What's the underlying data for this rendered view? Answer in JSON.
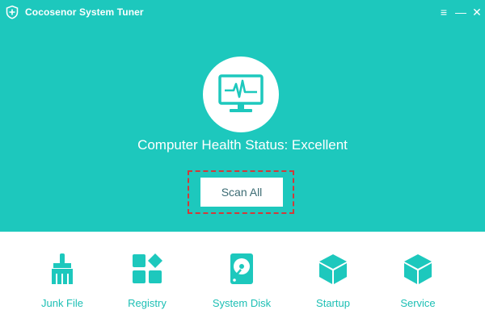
{
  "app": {
    "title": "Cocosenor System Tuner",
    "icon": "shield-cross-icon",
    "window_controls": [
      "menu-icon",
      "minimize-icon",
      "close-icon"
    ],
    "accent_color": "#1dc8bd"
  },
  "health": {
    "icon": "monitor-heartbeat-icon",
    "status": "Computer Health Status: Excellent"
  },
  "scan": {
    "label": "Scan All"
  },
  "tools": [
    {
      "label": "Junk File",
      "icon": "broom-icon"
    },
    {
      "label": "Registry",
      "icon": "grid-diamond-icon"
    },
    {
      "label": "System Disk",
      "icon": "hard-disk-icon"
    },
    {
      "label": "Startup",
      "icon": "cube-icon"
    },
    {
      "label": "Service",
      "icon": "cube-icon"
    }
  ]
}
